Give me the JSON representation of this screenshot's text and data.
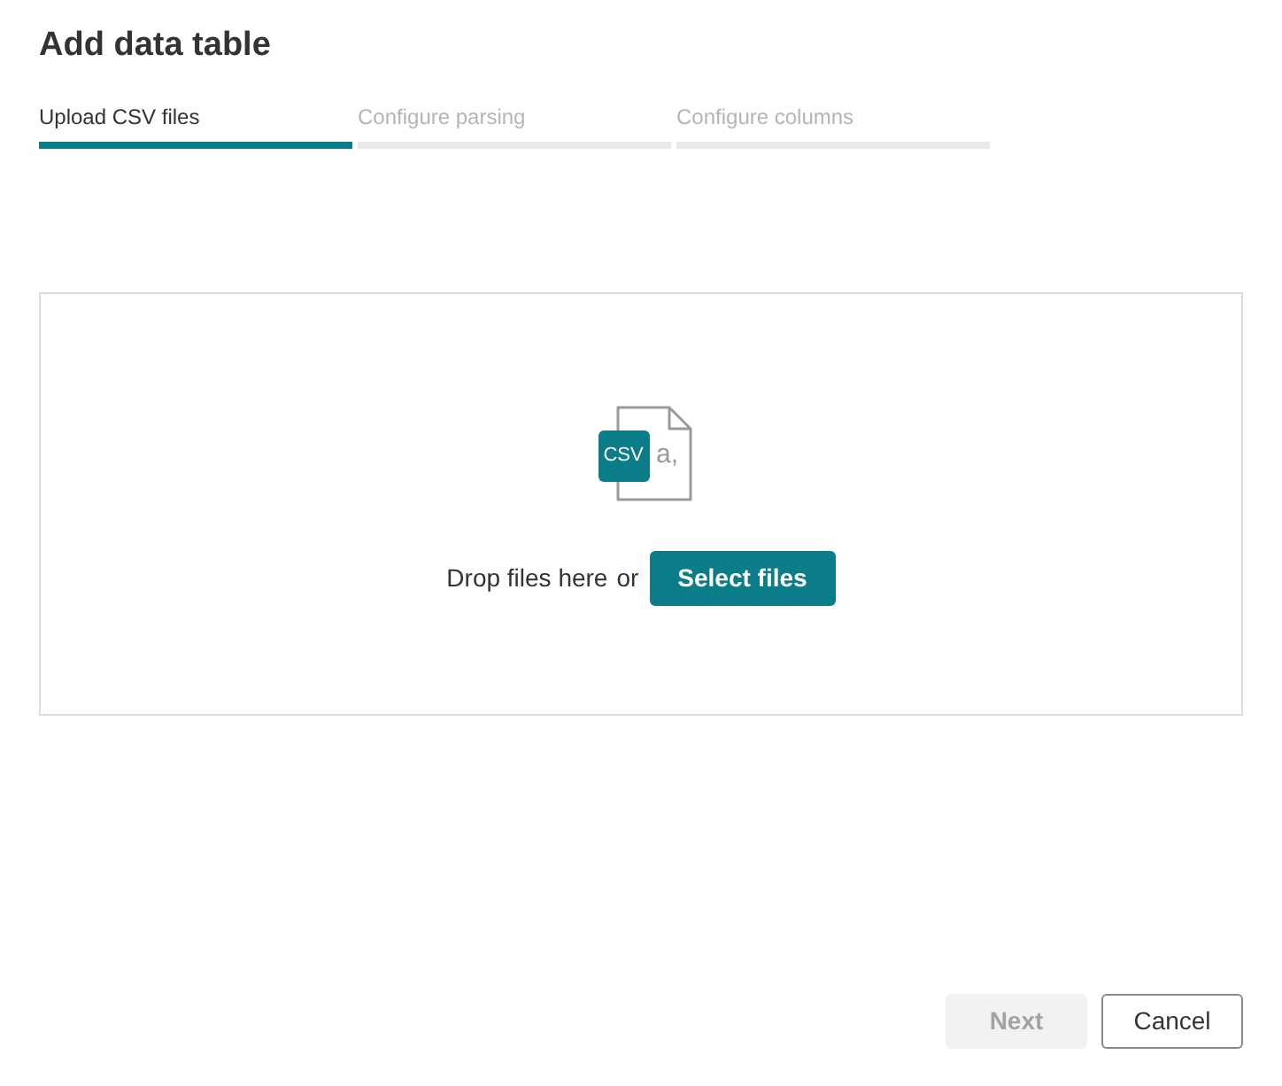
{
  "dialog": {
    "title": "Add data table"
  },
  "steps": [
    {
      "label": "Upload CSV files",
      "selected": true
    },
    {
      "label": "Configure parsing",
      "selected": false
    },
    {
      "label": "Configure columns",
      "selected": false
    }
  ],
  "drop_zone": {
    "file_icon": {
      "badge": "CSV",
      "sample": "a,"
    },
    "prompt": "Drop files here",
    "separator": "or",
    "button": "Select files"
  },
  "footer_buttons": [
    {
      "label": "Next",
      "kind": "primary",
      "disabled": true
    },
    {
      "label": "Cancel",
      "kind": "secondary",
      "disabled": false
    }
  ]
}
